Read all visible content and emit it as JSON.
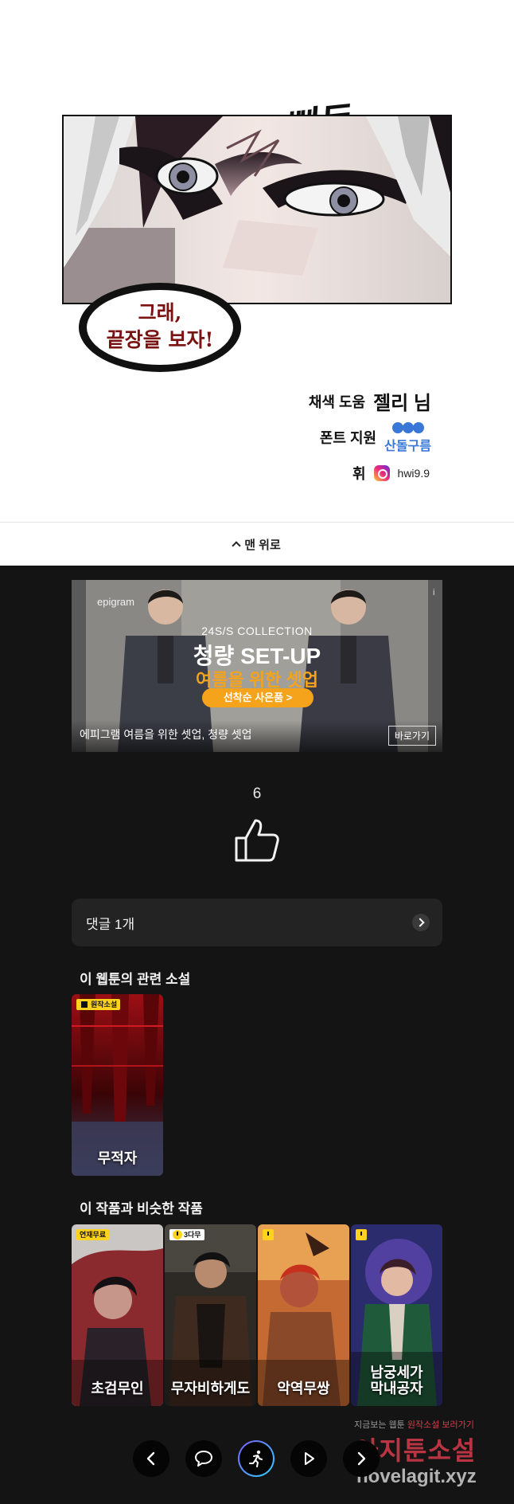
{
  "comic": {
    "sfx": "빠득-",
    "bubble_line1": "그래,",
    "bubble_line2": "끝장을 보자!",
    "credits": {
      "color_label": "채색 도움",
      "color_name": "젤리 님",
      "font_label": "폰트 지원",
      "font_name": "산돌구름",
      "hwi_label": "휘",
      "hwi_handle": "hwi9.9"
    }
  },
  "to_top": {
    "label": "맨 위로"
  },
  "ad": {
    "logo": "epigram",
    "collection": "24S/S COLLECTION",
    "headline": "청량 SET-UP",
    "sub": "여름을 위한 셋업",
    "cta": "선착순 사은품 >",
    "caption": "에피그램 여름을 위한 셋업, 청량 셋업",
    "go": "바로가기",
    "info": "i"
  },
  "like": {
    "count": "6"
  },
  "comments": {
    "label": "댓글 1개"
  },
  "related": {
    "title": "이 웹툰의 관련 소설",
    "items": [
      {
        "badge": "원작소설",
        "title": "무적자"
      }
    ]
  },
  "similar": {
    "title": "이 작품과 비슷한 작품",
    "items": [
      {
        "badge": "연재무료",
        "title": "초검무인"
      },
      {
        "badge": "3다무",
        "title": "무자비하게도"
      },
      {
        "badge": "",
        "title": "악역무쌍"
      },
      {
        "badge": "",
        "title_line1": "남궁세가",
        "title_line2": "막내공자"
      }
    ]
  },
  "watermark": {
    "line1_a": "지금보는 웹툰",
    "line1_b": "원작소설 보러가기",
    "line2": "아지툰소설",
    "line3": "novelagit.xyz"
  },
  "colors": {
    "background": "#141414",
    "accent_yellow": "#ffd21e",
    "ad_orange": "#f5a31a",
    "sandol_blue": "#3a78d8",
    "watermark_red": "#d63b4c"
  }
}
